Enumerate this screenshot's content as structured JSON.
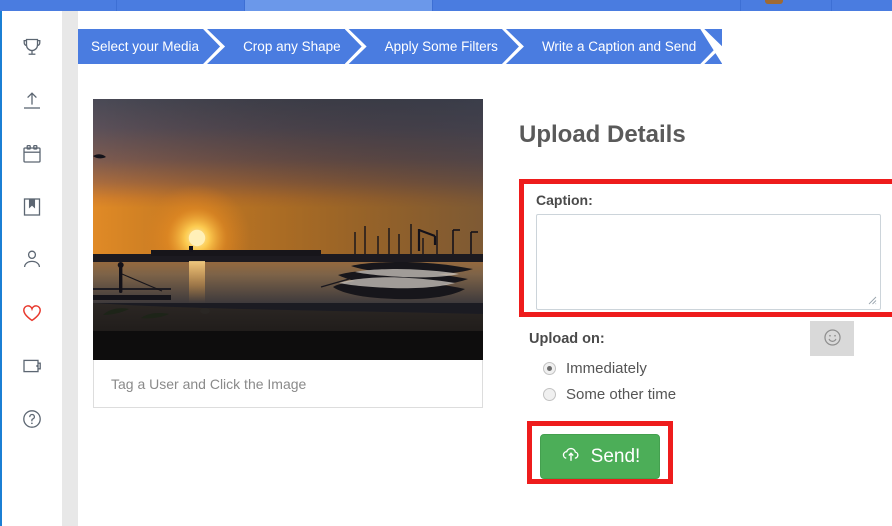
{
  "navbar": {
    "brand_label": "",
    "items": [
      {
        "label": "",
        "active": false
      },
      {
        "label": "",
        "active": true
      },
      {
        "label": "",
        "active": false
      }
    ],
    "avatar_label": ""
  },
  "sidebar": {
    "items": [
      {
        "name": "trophy-icon",
        "label": "Trophy"
      },
      {
        "name": "upload-icon",
        "label": "Upload"
      },
      {
        "name": "calendar-icon",
        "label": "Calendar"
      },
      {
        "name": "bookmark-icon",
        "label": "Bookmarks"
      },
      {
        "name": "user-icon",
        "label": "Profile"
      },
      {
        "name": "heart-icon",
        "label": "Favourites"
      },
      {
        "name": "wallet-icon",
        "label": "Wallet"
      },
      {
        "name": "help-icon",
        "label": "Help"
      }
    ]
  },
  "stepper": {
    "steps": [
      {
        "label": "Select your Media"
      },
      {
        "label": "Crop any Shape"
      },
      {
        "label": "Apply Some Filters"
      },
      {
        "label": "Write a Caption and Send"
      }
    ]
  },
  "media": {
    "alt": "Sunset over a harbour with moored fishing boats",
    "tag_hint": "Tag a User and Click the Image"
  },
  "panel": {
    "title": "Upload Details",
    "caption": {
      "label": "Caption:",
      "value": "",
      "placeholder": ""
    },
    "upload_on": {
      "label": "Upload on:",
      "options": [
        {
          "label": "Immediately",
          "selected": true
        },
        {
          "label": "Some other time",
          "selected": false
        }
      ]
    },
    "emoji_button": {
      "icon": "smiley-icon",
      "label": ""
    },
    "send_button": {
      "label": "Send!",
      "icon": "cloud-upload-icon"
    }
  },
  "colors": {
    "nav_blue": "#4a7ce0",
    "nav_blue_active": "#6b98ea",
    "step_blue": "#4a7ce0",
    "highlight_red": "#ee1c1c",
    "send_green": "#4cae58",
    "heart_red": "#e8392e",
    "icon_gray": "#5c6672",
    "gutter_gray": "#e8e8e8"
  }
}
